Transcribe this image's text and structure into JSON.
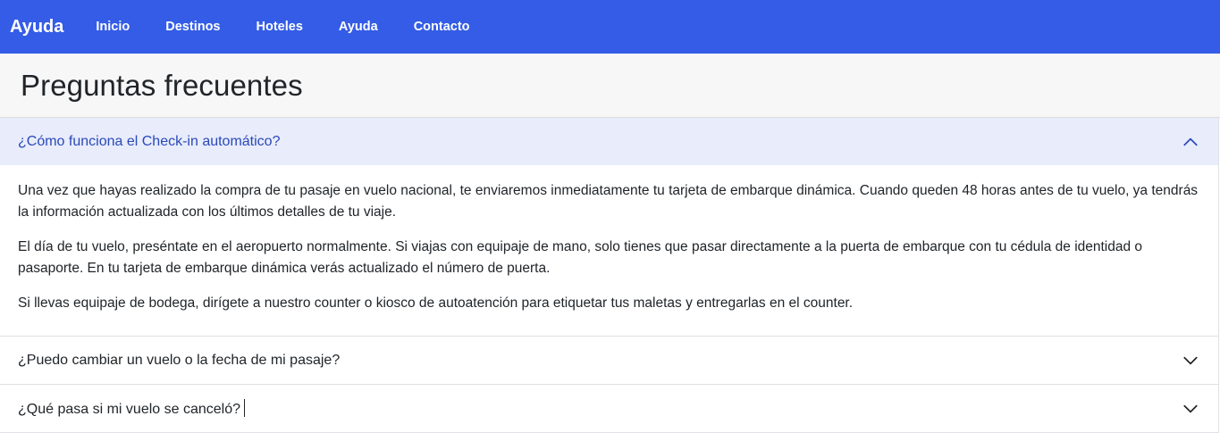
{
  "navbar": {
    "brand": "Ayuda",
    "links": [
      "Inicio",
      "Destinos",
      "Hoteles",
      "Ayuda",
      "Contacto"
    ]
  },
  "page": {
    "title": "Preguntas frecuentes"
  },
  "faq": [
    {
      "question": "¿Cómo funciona el Check-in automático?",
      "expanded": true,
      "answer": [
        "Una vez que hayas realizado la compra de tu pasaje en vuelo nacional, te enviaremos inmediatamente tu tarjeta de embarque dinámica. Cuando queden 48 horas antes de tu vuelo, ya tendrás la información actualizada con los últimos detalles de tu viaje.",
        "El día de tu vuelo, preséntate en el aeropuerto normalmente. Si viajas con equipaje de mano, solo tienes que pasar directamente a la puerta de embarque con tu cédula de identidad o pasaporte. En tu tarjeta de embarque dinámica verás actualizado el número de puerta.",
        "Si llevas equipaje de bodega, dirígete a nuestro counter o kiosco de autoatención para etiquetar tus maletas y entregarlas en el counter."
      ]
    },
    {
      "question": "¿Puedo cambiar un vuelo o la fecha de mi pasaje?",
      "expanded": false
    },
    {
      "question": "¿Qué pasa si mi vuelo se canceló?",
      "expanded": false
    }
  ],
  "colors": {
    "navbar_bg": "#345ce6",
    "active_header_bg": "#e8ecfb",
    "active_header_text": "#2a49b8"
  }
}
